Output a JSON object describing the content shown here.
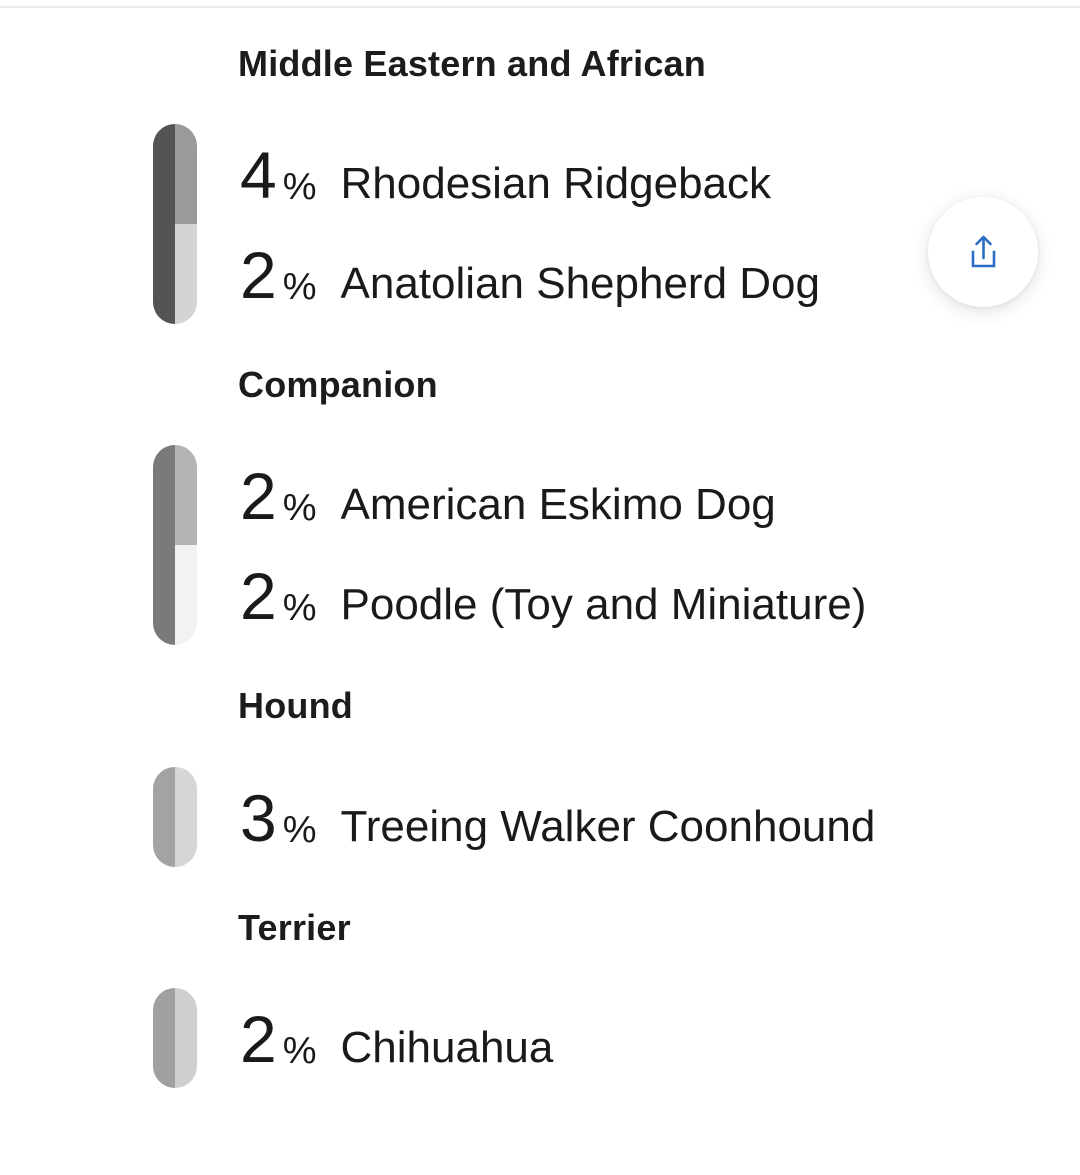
{
  "groups": [
    {
      "title": "Middle Eastern and African",
      "breeds": [
        {
          "percent": "4",
          "percent_sign": "%",
          "name": "Rhodesian Ridgeback",
          "fraction": 0.04
        },
        {
          "percent": "2",
          "percent_sign": "%",
          "name": "Anatolian Shepherd Dog",
          "fraction": 0.02
        }
      ],
      "bar_colors": {
        "left": "#545454",
        "segments": [
          "#9a9a9a",
          "#d4d4d4"
        ]
      }
    },
    {
      "title": "Companion",
      "breeds": [
        {
          "percent": "2",
          "percent_sign": "%",
          "name": "American Eskimo Dog",
          "fraction": 0.02
        },
        {
          "percent": "2",
          "percent_sign": "%",
          "name": "Poodle (Toy and Miniature)",
          "fraction": 0.02
        }
      ],
      "bar_colors": {
        "left": "#7a7a7a",
        "segments": [
          "#b4b4b4",
          "#f2f2f2"
        ]
      }
    },
    {
      "title": "Hound",
      "breeds": [
        {
          "percent": "3",
          "percent_sign": "%",
          "name": "Treeing Walker Coonhound",
          "fraction": 0.03
        }
      ],
      "bar_colors": {
        "left": "#a3a3a3",
        "segments": [
          "#d6d6d6"
        ]
      }
    },
    {
      "title": "Terrier",
      "breeds": [
        {
          "percent": "2",
          "percent_sign": "%",
          "name": "Chihuahua",
          "fraction": 0.02
        }
      ],
      "bar_colors": {
        "left": "#a0a0a0",
        "segments": [
          "#cfcfcf"
        ]
      }
    }
  ],
  "share": {
    "icon": "share-icon",
    "color": "#2b6cc4"
  }
}
